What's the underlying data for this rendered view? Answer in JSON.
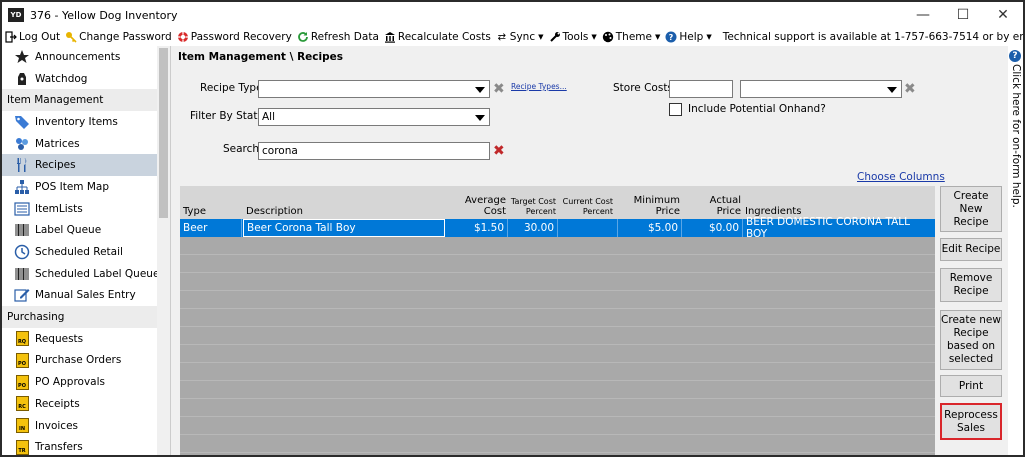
{
  "window": {
    "icon_text": "YD",
    "title": "376 - Yellow Dog Inventory",
    "minimize": "—",
    "maximize": "☐",
    "close": "✕"
  },
  "toolbar": {
    "items": [
      {
        "label": "Log Out",
        "icon": "logout-icon"
      },
      {
        "label": "Change Password",
        "icon": "key-icon"
      },
      {
        "label": "Password Recovery",
        "icon": "lifebuoy-icon"
      },
      {
        "label": "Refresh Data",
        "icon": "refresh-icon"
      },
      {
        "label": "Recalculate Costs",
        "icon": "bank-icon"
      },
      {
        "label": "Sync",
        "icon": "sync-icon"
      },
      {
        "label": "Tools",
        "icon": "wrench-icon"
      },
      {
        "label": "Theme",
        "icon": "palette-icon"
      },
      {
        "label": "Help",
        "icon": "help-icon"
      }
    ],
    "support": "Technical support is available at 1-757-663-7514 or by emailing support@yellowdogsoftware.com."
  },
  "sidebar": {
    "items": [
      {
        "kind": "item",
        "label": "Announcements",
        "icon": "announcement-icon"
      },
      {
        "kind": "item",
        "label": "Watchdog",
        "icon": "watchdog-icon"
      },
      {
        "kind": "header",
        "label": "Item Management"
      },
      {
        "kind": "item",
        "label": "Inventory Items",
        "icon": "tag-icon"
      },
      {
        "kind": "item",
        "label": "Matrices",
        "icon": "matrix-icon"
      },
      {
        "kind": "item",
        "label": "Recipes",
        "icon": "utensils-icon",
        "active": true
      },
      {
        "kind": "item",
        "label": "POS Item Map",
        "icon": "hierarchy-icon"
      },
      {
        "kind": "item",
        "label": "ItemLists",
        "icon": "list-icon"
      },
      {
        "kind": "item",
        "label": "Label Queue",
        "icon": "barcode-icon"
      },
      {
        "kind": "item",
        "label": "Scheduled Retail",
        "icon": "clock-icon"
      },
      {
        "kind": "item",
        "label": "Scheduled Label Queue",
        "icon": "barcode-icon"
      },
      {
        "kind": "item",
        "label": "Manual Sales Entry",
        "icon": "edit-icon"
      },
      {
        "kind": "header",
        "label": "Purchasing"
      },
      {
        "kind": "item",
        "label": "Requests",
        "icon": "doc-rq-icon",
        "code": "RQ"
      },
      {
        "kind": "item",
        "label": "Purchase Orders",
        "icon": "doc-po-icon",
        "code": "PO"
      },
      {
        "kind": "item",
        "label": "PO Approvals",
        "icon": "doc-po-icon",
        "code": "PO"
      },
      {
        "kind": "item",
        "label": "Receipts",
        "icon": "doc-rc-icon",
        "code": "RC"
      },
      {
        "kind": "item",
        "label": "Invoices",
        "icon": "doc-in-icon",
        "code": "IN"
      },
      {
        "kind": "item",
        "label": "Transfers",
        "icon": "doc-tr-icon",
        "code": "TR"
      }
    ]
  },
  "main": {
    "breadcrumb": "Item Management \\ Recipes",
    "recipe_type_label": "Recipe Type",
    "recipe_type_value": "",
    "recipe_types_link": "Recipe Types...",
    "filter_status_label": "Filter By Status",
    "filter_status_value": "All",
    "search_label": "Search",
    "search_value": "corona",
    "store_costs_label": "Store Costs",
    "store_costs_value": "",
    "store_costs_select": "",
    "include_onhand_label": "Include Potential Onhand?",
    "choose_columns": "Choose Columns"
  },
  "grid": {
    "headers": {
      "type": "Type",
      "description": "Description",
      "avg_cost_1": "Average",
      "avg_cost_2": "Cost",
      "target_1": "Target Cost",
      "target_2": "Percent",
      "current_1": "Current Cost",
      "current_2": "Percent",
      "min_price_1": "Minimum",
      "min_price_2": "Price",
      "actual_1": "Actual",
      "actual_2": "Price",
      "ingredients": "Ingredients"
    },
    "rows": [
      {
        "type": "Beer",
        "description": "Beer Corona Tall Boy",
        "avg_cost": "$1.50",
        "target": "30.00",
        "current": "",
        "min_price": "$5.00",
        "actual": "$0.00",
        "ingredients": "BEER DOMESTIC CORONA TALL BOY"
      }
    ]
  },
  "actions": {
    "create_new": "Create New Recipe",
    "edit": "Edit Recipe",
    "remove": "Remove Recipe",
    "create_based": "Create new Recipe based on selected",
    "print": "Print",
    "reprocess": "Reprocess Sales"
  },
  "help_strip": {
    "icon": "?",
    "text": "Click here for on-form help."
  },
  "colors": {
    "selection": "#0078d7",
    "grid_bg": "#a9a9a9",
    "highlight_border": "#d9262b"
  }
}
